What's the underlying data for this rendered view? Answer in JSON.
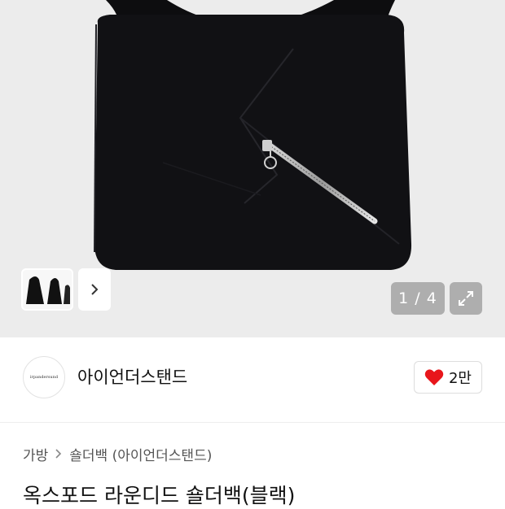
{
  "gallery": {
    "counter": "1 / 4",
    "thumbnail_next_icon": "chevron-right-icon",
    "expand_icon": "expand-arrows-icon"
  },
  "brand": {
    "logo_text": "irpandersund",
    "name": "아이언더스탠드",
    "like_icon": "heart-icon",
    "like_color": "#e8161b",
    "like_count": "2만"
  },
  "breadcrumb": {
    "items": [
      "가방",
      "숄더백 (아이언더스탠드)"
    ],
    "separator_icon": "chevron-right-icon"
  },
  "product": {
    "title": "옥스포드 라운디드 숄더백(블랙)"
  }
}
